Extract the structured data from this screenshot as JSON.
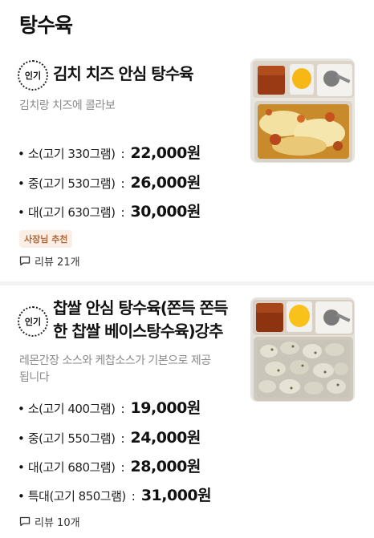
{
  "section": {
    "title": "탕수육"
  },
  "items": [
    {
      "popular_label": "인기",
      "name": "김치 치즈 안심 탕수육",
      "description": "김치랑 치즈에 콜라보",
      "prices": [
        {
          "bullet": "•",
          "size": "소(고기 330그램)",
          "price": "22,000원"
        },
        {
          "bullet": "•",
          "size": "중(고기 530그램)",
          "price": "26,000원"
        },
        {
          "bullet": "•",
          "size": "대(고기 630그램)",
          "price": "30,000원"
        }
      ],
      "badge": "사장님 추천",
      "reviews": "리뷰 21개",
      "image_icon": "food-photo-kimchi-cheese-tangsuyuk"
    },
    {
      "popular_label": "인기",
      "name": "찹쌀 안심 탕수육(쫀득 쫀득한 찹쌀 베이스탕수육)강추",
      "name_line1": "찹쌀 안심 탕수육(쫀득 쫀득",
      "name_line2": "한 찹쌀 베이스탕수육)강추",
      "description": "레몬간장 소스와 케찹소스가 기본으로 제공됩니다",
      "description_line1": "레몬간장 소스와 케찹소스가 기본으로 제공",
      "description_line2": "됩니다",
      "prices": [
        {
          "bullet": "•",
          "size": "소(고기 400그램)",
          "price": "19,000원"
        },
        {
          "bullet": "•",
          "size": "중(고기 550그램)",
          "price": "24,000원"
        },
        {
          "bullet": "•",
          "size": "대(고기 680그램)",
          "price": "28,000원"
        },
        {
          "bullet": "•",
          "size": "특대(고기 850그램)",
          "price": "31,000원"
        }
      ],
      "reviews": "리뷰 10개",
      "image_icon": "food-photo-chapssal-tangsuyuk"
    }
  ],
  "colors": {
    "badge_bg": "#fbeee4",
    "badge_text": "#b0683a",
    "muted_text": "#8a8a8a",
    "divider": "#f2f2f2"
  }
}
